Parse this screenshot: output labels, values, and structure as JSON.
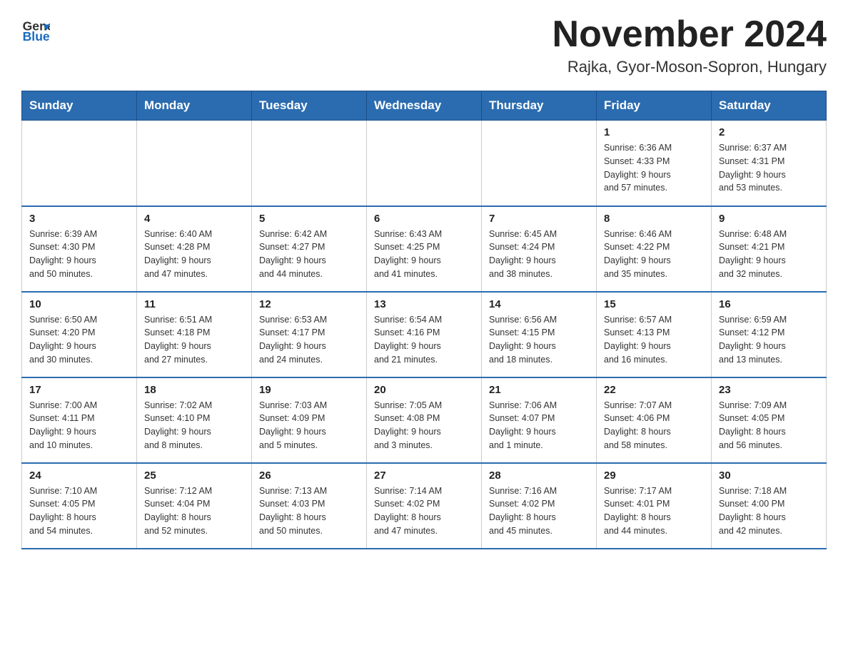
{
  "header": {
    "logo_text_general": "General",
    "logo_text_blue": "Blue",
    "month_title": "November 2024",
    "location": "Rajka, Gyor-Moson-Sopron, Hungary"
  },
  "days_of_week": [
    "Sunday",
    "Monday",
    "Tuesday",
    "Wednesday",
    "Thursday",
    "Friday",
    "Saturday"
  ],
  "weeks": [
    {
      "days": [
        {
          "num": "",
          "info": ""
        },
        {
          "num": "",
          "info": ""
        },
        {
          "num": "",
          "info": ""
        },
        {
          "num": "",
          "info": ""
        },
        {
          "num": "",
          "info": ""
        },
        {
          "num": "1",
          "info": "Sunrise: 6:36 AM\nSunset: 4:33 PM\nDaylight: 9 hours\nand 57 minutes."
        },
        {
          "num": "2",
          "info": "Sunrise: 6:37 AM\nSunset: 4:31 PM\nDaylight: 9 hours\nand 53 minutes."
        }
      ]
    },
    {
      "days": [
        {
          "num": "3",
          "info": "Sunrise: 6:39 AM\nSunset: 4:30 PM\nDaylight: 9 hours\nand 50 minutes."
        },
        {
          "num": "4",
          "info": "Sunrise: 6:40 AM\nSunset: 4:28 PM\nDaylight: 9 hours\nand 47 minutes."
        },
        {
          "num": "5",
          "info": "Sunrise: 6:42 AM\nSunset: 4:27 PM\nDaylight: 9 hours\nand 44 minutes."
        },
        {
          "num": "6",
          "info": "Sunrise: 6:43 AM\nSunset: 4:25 PM\nDaylight: 9 hours\nand 41 minutes."
        },
        {
          "num": "7",
          "info": "Sunrise: 6:45 AM\nSunset: 4:24 PM\nDaylight: 9 hours\nand 38 minutes."
        },
        {
          "num": "8",
          "info": "Sunrise: 6:46 AM\nSunset: 4:22 PM\nDaylight: 9 hours\nand 35 minutes."
        },
        {
          "num": "9",
          "info": "Sunrise: 6:48 AM\nSunset: 4:21 PM\nDaylight: 9 hours\nand 32 minutes."
        }
      ]
    },
    {
      "days": [
        {
          "num": "10",
          "info": "Sunrise: 6:50 AM\nSunset: 4:20 PM\nDaylight: 9 hours\nand 30 minutes."
        },
        {
          "num": "11",
          "info": "Sunrise: 6:51 AM\nSunset: 4:18 PM\nDaylight: 9 hours\nand 27 minutes."
        },
        {
          "num": "12",
          "info": "Sunrise: 6:53 AM\nSunset: 4:17 PM\nDaylight: 9 hours\nand 24 minutes."
        },
        {
          "num": "13",
          "info": "Sunrise: 6:54 AM\nSunset: 4:16 PM\nDaylight: 9 hours\nand 21 minutes."
        },
        {
          "num": "14",
          "info": "Sunrise: 6:56 AM\nSunset: 4:15 PM\nDaylight: 9 hours\nand 18 minutes."
        },
        {
          "num": "15",
          "info": "Sunrise: 6:57 AM\nSunset: 4:13 PM\nDaylight: 9 hours\nand 16 minutes."
        },
        {
          "num": "16",
          "info": "Sunrise: 6:59 AM\nSunset: 4:12 PM\nDaylight: 9 hours\nand 13 minutes."
        }
      ]
    },
    {
      "days": [
        {
          "num": "17",
          "info": "Sunrise: 7:00 AM\nSunset: 4:11 PM\nDaylight: 9 hours\nand 10 minutes."
        },
        {
          "num": "18",
          "info": "Sunrise: 7:02 AM\nSunset: 4:10 PM\nDaylight: 9 hours\nand 8 minutes."
        },
        {
          "num": "19",
          "info": "Sunrise: 7:03 AM\nSunset: 4:09 PM\nDaylight: 9 hours\nand 5 minutes."
        },
        {
          "num": "20",
          "info": "Sunrise: 7:05 AM\nSunset: 4:08 PM\nDaylight: 9 hours\nand 3 minutes."
        },
        {
          "num": "21",
          "info": "Sunrise: 7:06 AM\nSunset: 4:07 PM\nDaylight: 9 hours\nand 1 minute."
        },
        {
          "num": "22",
          "info": "Sunrise: 7:07 AM\nSunset: 4:06 PM\nDaylight: 8 hours\nand 58 minutes."
        },
        {
          "num": "23",
          "info": "Sunrise: 7:09 AM\nSunset: 4:05 PM\nDaylight: 8 hours\nand 56 minutes."
        }
      ]
    },
    {
      "days": [
        {
          "num": "24",
          "info": "Sunrise: 7:10 AM\nSunset: 4:05 PM\nDaylight: 8 hours\nand 54 minutes."
        },
        {
          "num": "25",
          "info": "Sunrise: 7:12 AM\nSunset: 4:04 PM\nDaylight: 8 hours\nand 52 minutes."
        },
        {
          "num": "26",
          "info": "Sunrise: 7:13 AM\nSunset: 4:03 PM\nDaylight: 8 hours\nand 50 minutes."
        },
        {
          "num": "27",
          "info": "Sunrise: 7:14 AM\nSunset: 4:02 PM\nDaylight: 8 hours\nand 47 minutes."
        },
        {
          "num": "28",
          "info": "Sunrise: 7:16 AM\nSunset: 4:02 PM\nDaylight: 8 hours\nand 45 minutes."
        },
        {
          "num": "29",
          "info": "Sunrise: 7:17 AM\nSunset: 4:01 PM\nDaylight: 8 hours\nand 44 minutes."
        },
        {
          "num": "30",
          "info": "Sunrise: 7:18 AM\nSunset: 4:00 PM\nDaylight: 8 hours\nand 42 minutes."
        }
      ]
    }
  ]
}
